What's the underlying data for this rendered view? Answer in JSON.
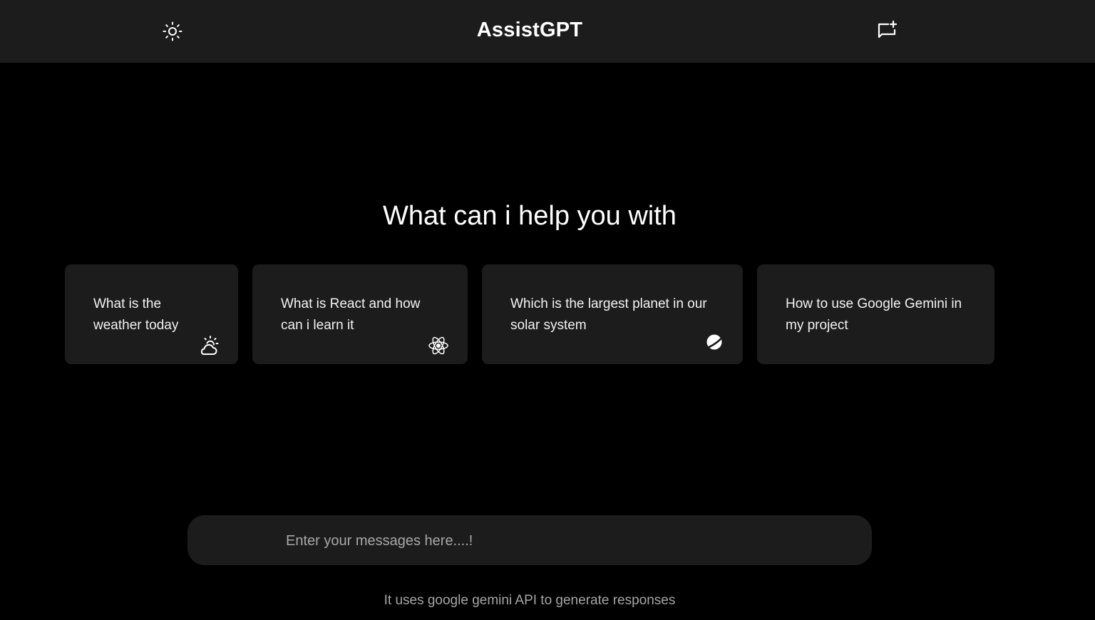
{
  "header": {
    "title": "AssistGPT",
    "theme_icon": "sun-icon",
    "new_chat_icon": "new-chat-icon"
  },
  "main": {
    "headline": "What can i help you with",
    "cards": [
      {
        "text": "What is the weather today",
        "icon": "weather-partly-cloudy-icon"
      },
      {
        "text": "What is React and how can i learn it",
        "icon": "react-atom-icon"
      },
      {
        "text": "Which is the largest planet in our solar system",
        "icon": "planet-icon"
      },
      {
        "text": "How to use Google Gemini in my project",
        "icon": ""
      }
    ]
  },
  "composer": {
    "placeholder": "Enter your messages here....!",
    "value": ""
  },
  "footer": {
    "note": "It uses google gemini API to generate responses"
  },
  "colors": {
    "background": "#000000",
    "surface": "#1c1c1c",
    "text": "#f2f2f2",
    "muted_text": "#a6a6a6"
  }
}
